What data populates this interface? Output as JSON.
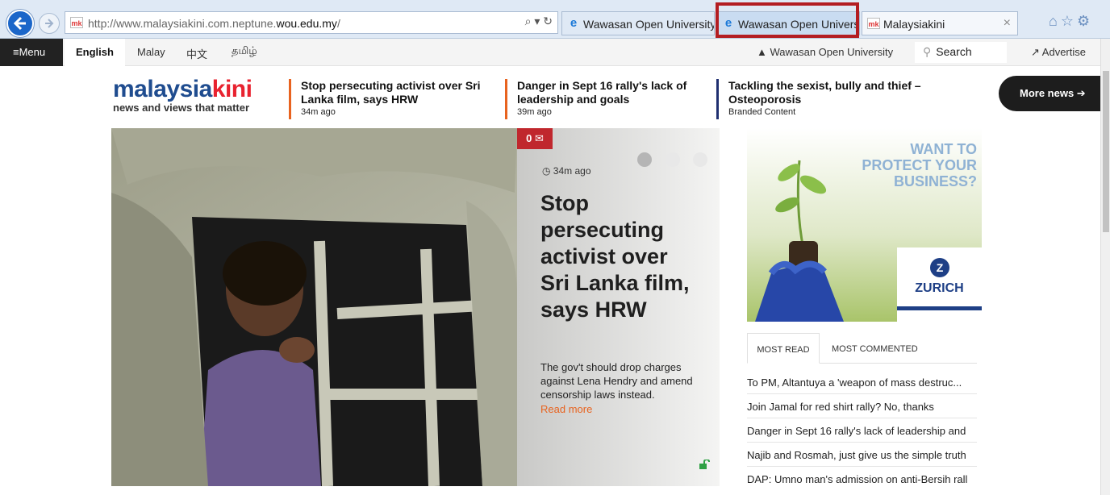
{
  "browser": {
    "address_url_plain": "http://www.malaysiakini.com.neptune.",
    "address_url_domain": "wou.edu.my",
    "address_url_end": "/",
    "address_tools": "⌕ ▾ ↻",
    "favicon_mk": "mk",
    "favicon_ie": "e",
    "tabs": [
      {
        "label": "Wawasan Open University ..."
      },
      {
        "label": "Wawasan Open University"
      },
      {
        "label": "Malaysiakini",
        "close": "×"
      }
    ],
    "toolbar_icons": "⌂☆⚙",
    "highlight_color": "#b31d22"
  },
  "site_nav": {
    "menu_label": "≡Menu",
    "languages": [
      "English",
      "Malay",
      "中文",
      "தமிழ்"
    ],
    "account_label": "▲ Wawasan Open University",
    "search_label": "Search",
    "advertise_label": "↗ Advertise"
  },
  "logo": {
    "main_a": "malaysia",
    "main_b": "kini",
    "tagline": "news and views that matter",
    "color_primary": "#1f4c8f",
    "color_accent": "#e8222f"
  },
  "headlines": [
    {
      "title": "Stop persecuting activist over Sri Lanka film, says HRW",
      "time": "34m ago"
    },
    {
      "title": "Danger in Sept 16 rally's lack of leadership and goals",
      "time": "39m ago"
    },
    {
      "title": "Tackling the sexist, bully and thief – Osteoporosis",
      "time": "Branded Content"
    }
  ],
  "more_news_label": "More news ➔",
  "hero": {
    "comment_count": "0 ✉",
    "time": "◷ 34m ago",
    "title": "Stop persecuting activist over Sri Lanka film, says HRW",
    "summary": "The gov't should drop charges against Lena Hendry and amend censorship laws instead.",
    "read_more": "Read more",
    "badge_color": "#c0272d"
  },
  "ad": {
    "headline": "WANT TO\nPROTECT YOUR\nBUSINESS?",
    "brand": "ZURICH",
    "brand_mark": "Z"
  },
  "most_read": {
    "tabs": [
      "MOST READ",
      "MOST COMMENTED"
    ],
    "items": [
      "To PM, Altantuya a 'weapon of mass destruc...",
      "Join Jamal for red shirt rally? No, thanks",
      "Danger in Sept 16 rally's lack of leadership and",
      "Najib and Rosmah, just give us the simple truth",
      "DAP: Umno man's admission on anti-Bersih rall"
    ]
  }
}
